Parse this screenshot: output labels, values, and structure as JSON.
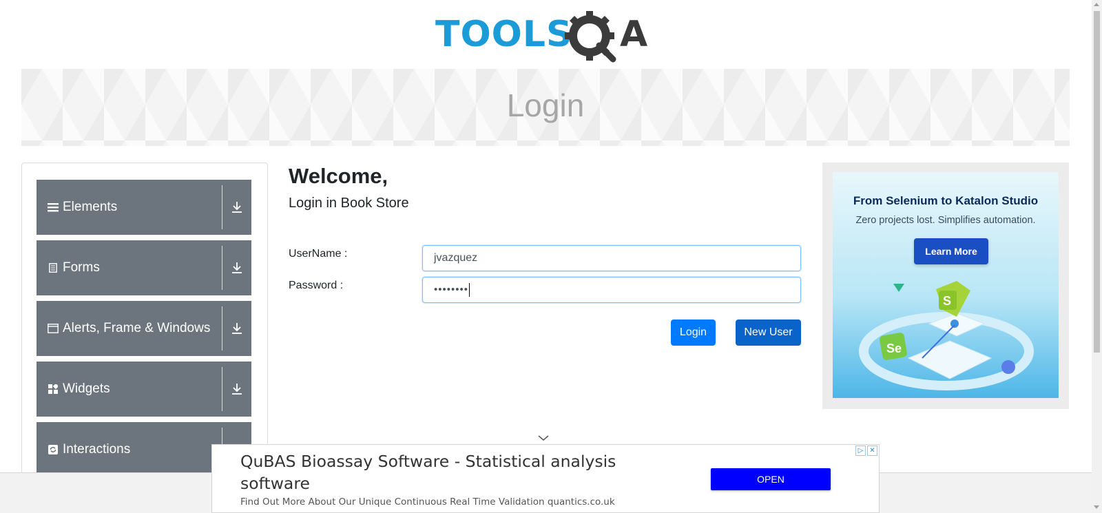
{
  "header": {
    "logo_text_left": "TOOLS",
    "logo_text_right": "A",
    "brand_color": "#1b9bd7"
  },
  "banner": {
    "title": "Login"
  },
  "sidebar": {
    "items": [
      {
        "label": "Elements",
        "icon": "list-icon"
      },
      {
        "label": "Forms",
        "icon": "document-icon"
      },
      {
        "label": "Alerts, Frame & Windows",
        "icon": "window-icon"
      },
      {
        "label": "Widgets",
        "icon": "widgets-icon"
      },
      {
        "label": "Interactions",
        "icon": "refresh-icon"
      }
    ],
    "menu_color": "#6c757d"
  },
  "main": {
    "welcome": "Welcome,",
    "subtitle": "Login in Book Store",
    "username_label": "UserName :",
    "username_value": "jvazquez",
    "password_label": "Password :",
    "password_value": "••••••••",
    "login_button": "Login",
    "new_user_button": "New User",
    "accent_color": "#007bff"
  },
  "ad_right": {
    "title": "From Selenium to Katalon Studio",
    "subtitle": "Zero projects lost. Simplifies automation.",
    "button": "Learn More"
  },
  "ad_bottom": {
    "title": "QuBAS Bioassay Software - Statistical analysis software",
    "description": "Find Out More About Our Unique Continuous Real Time Validation quantics.co.uk",
    "button": "OPEN",
    "button_color": "#0000ff"
  }
}
